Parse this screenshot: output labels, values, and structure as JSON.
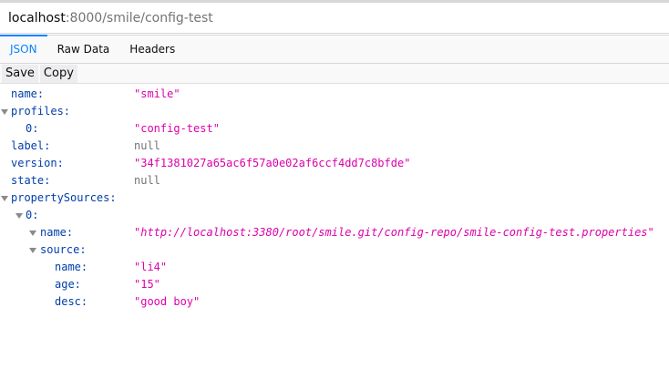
{
  "address_bar": {
    "host": "localhost",
    "rest": ":8000/smile/config-test"
  },
  "tabs": [
    {
      "label": "JSON",
      "active": true
    },
    {
      "label": "Raw Data",
      "active": false
    },
    {
      "label": "Headers",
      "active": false
    }
  ],
  "toolbar": {
    "save_label": "Save",
    "copy_label": "Copy"
  },
  "json_tree": {
    "name": {
      "key": "name:",
      "value": "\"smile\""
    },
    "profiles": {
      "key": "profiles:",
      "items": [
        {
          "key": "0:",
          "value": "\"config-test\""
        }
      ]
    },
    "label": {
      "key": "label:",
      "value": "null"
    },
    "version": {
      "key": "version:",
      "value": "\"34f1381027a65ac6f57a0e02af6ccf4dd7c8bfde\""
    },
    "state": {
      "key": "state:",
      "value": "null"
    },
    "propertySources": {
      "key": "propertySources:",
      "items": [
        {
          "key": "0:",
          "name": {
            "key": "name:",
            "value": "\"http://localhost:3380/root/smile.git/config-repo/smile-config-test.properties\""
          },
          "source": {
            "key": "source:",
            "name": {
              "key": "name:",
              "value": "\"li4\""
            },
            "age": {
              "key": "age:",
              "value": "\"15\""
            },
            "desc": {
              "key": "desc:",
              "value": "\"good boy\""
            }
          }
        }
      ]
    }
  },
  "colors": {
    "key": "#003eaa",
    "string": "#dd00a9",
    "null": "#737373",
    "active_tab": "#0a84ff"
  }
}
